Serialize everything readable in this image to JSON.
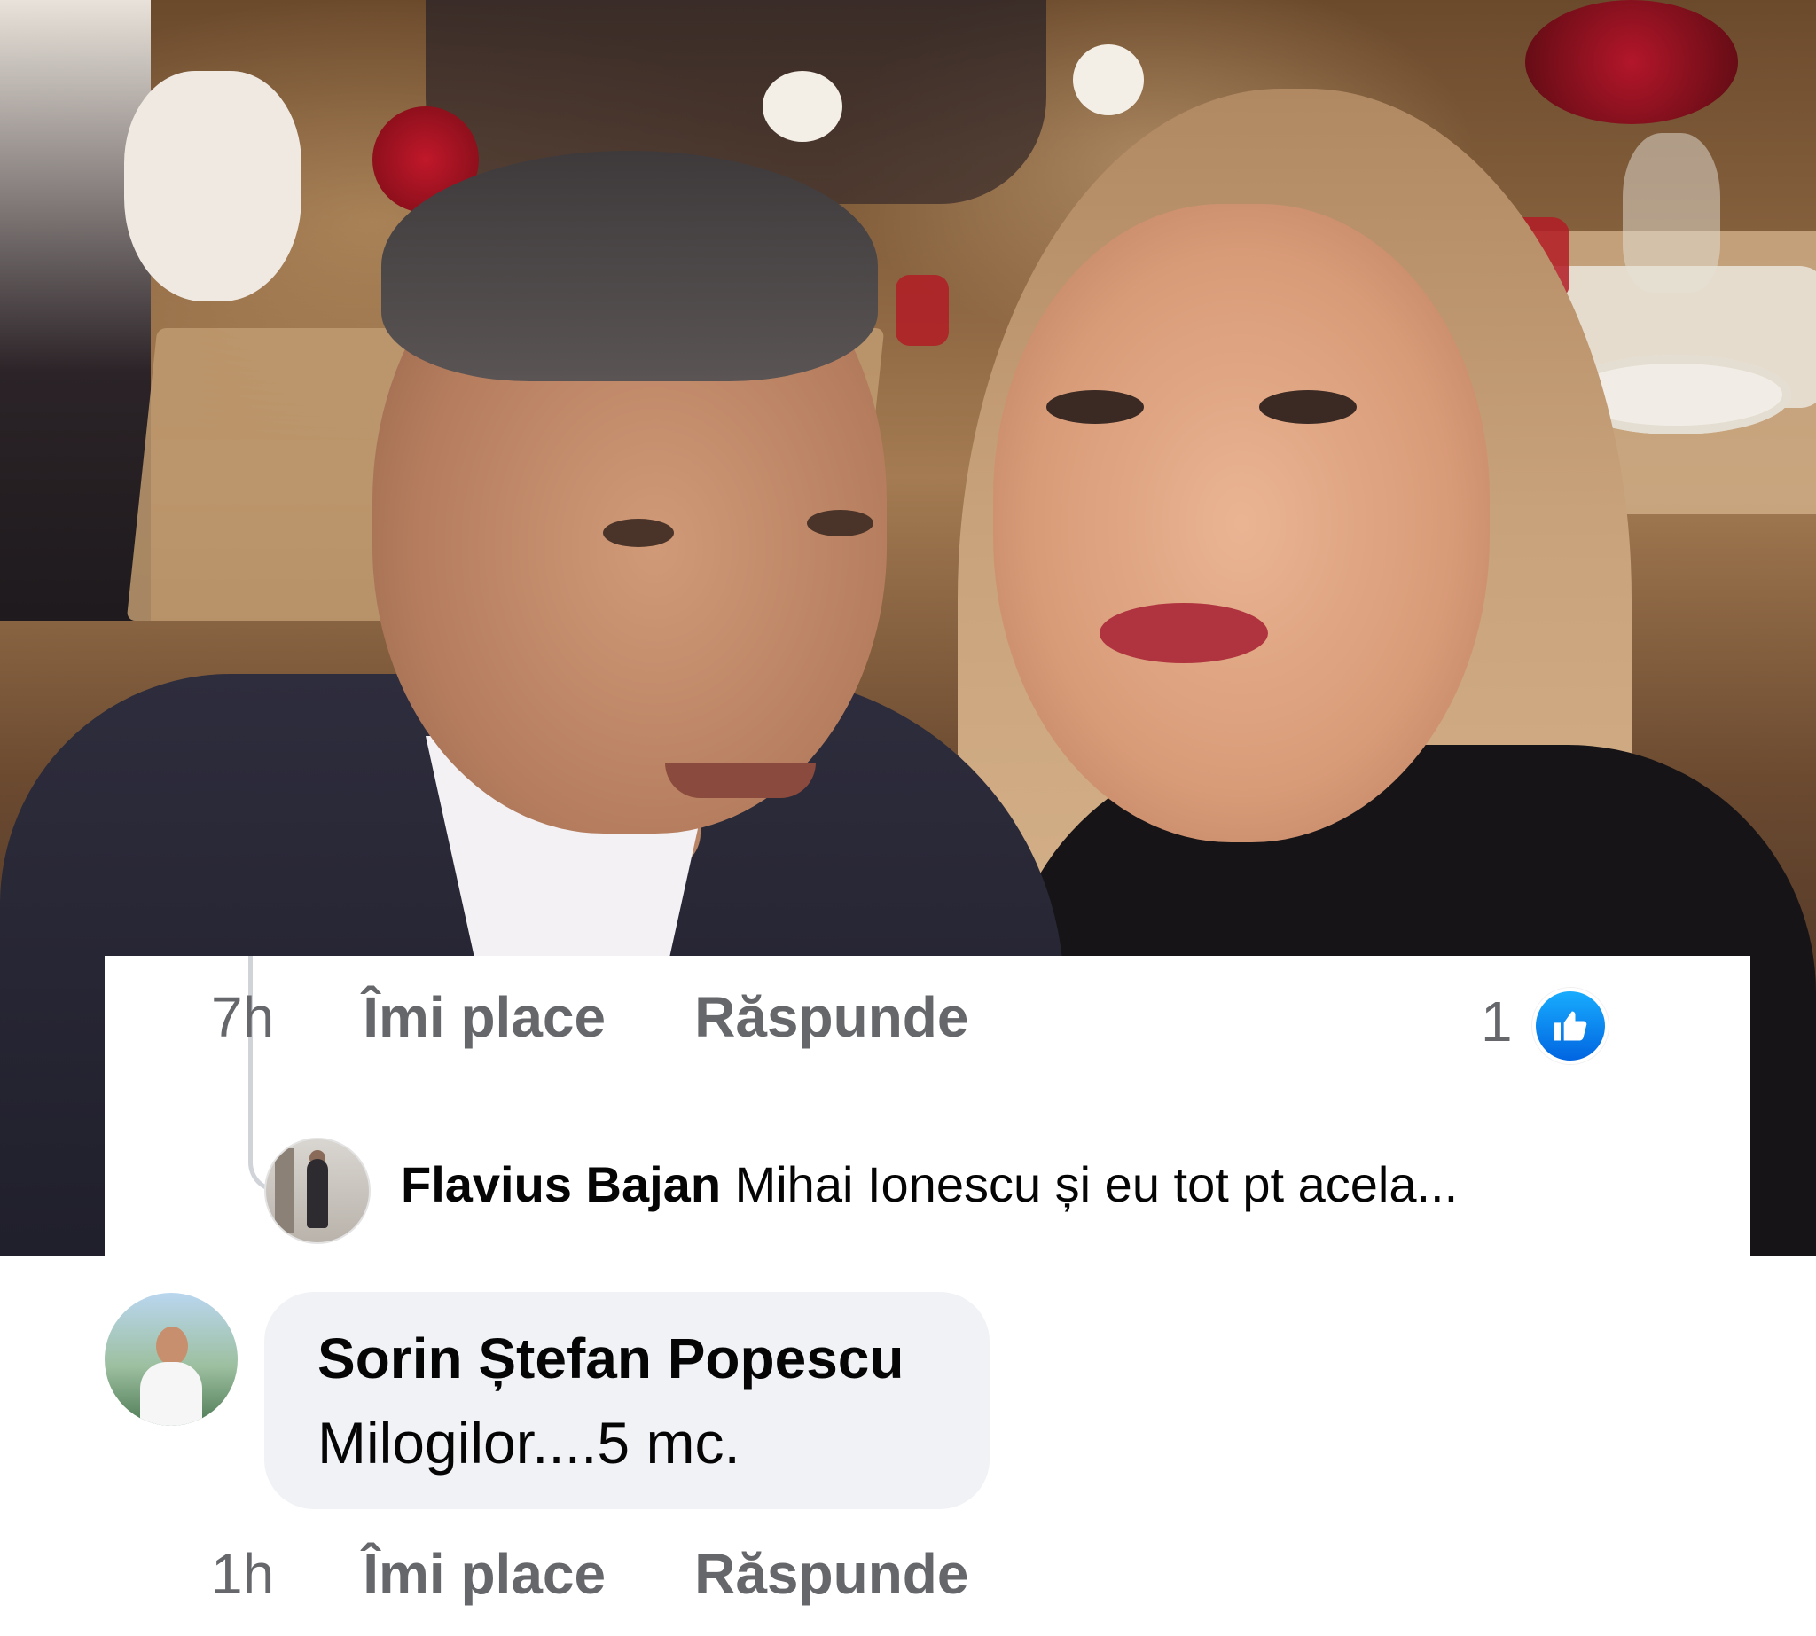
{
  "photo": {
    "description_icon": "selfie-photo"
  },
  "reply_comment": {
    "time": "7h",
    "like_label": "Îmi place",
    "reply_label": "Răspunde",
    "reaction_count": "1",
    "reaction_icon": "thumbs-up-icon"
  },
  "flavius_reply": {
    "author": "Flavius Bajan",
    "text": "Mihai Ionescu și eu tot pt acela..."
  },
  "sorin_comment": {
    "author": "Sorin Ștefan Popescu",
    "text": "Milogilor....5 mc.",
    "time": "1h",
    "like_label": "Îmi place",
    "reply_label": "Răspunde"
  },
  "colors": {
    "like_blue": "#1877f2",
    "meta_gray": "#65676b",
    "bubble_bg": "#f0f2f5"
  }
}
